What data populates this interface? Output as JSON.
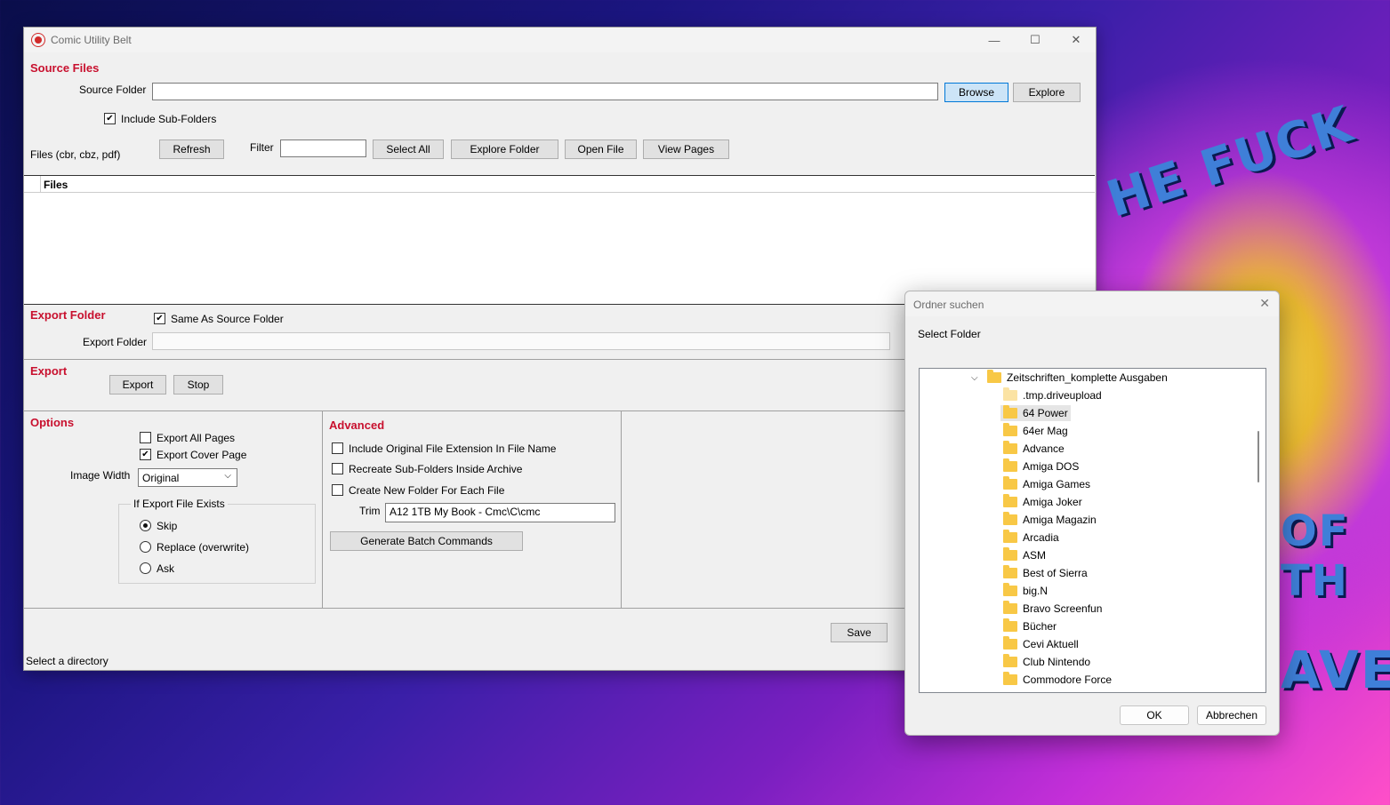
{
  "main": {
    "title": "Comic Utility Belt",
    "source_files": {
      "heading": "Source Files",
      "source_folder_label": "Source Folder",
      "source_folder_value": "",
      "browse": "Browse",
      "explore": "Explore",
      "include_sub_folders": "Include Sub-Folders",
      "files_label": "Files (cbr, cbz, pdf)",
      "refresh": "Refresh",
      "filter_label": "Filter",
      "filter_value": "",
      "select_all": "Select All",
      "explore_folder": "Explore Folder",
      "open_file": "Open File",
      "view_pages": "View Pages",
      "files_column": "Files"
    },
    "export_folder": {
      "heading": "Export Folder",
      "same_as_source": "Same As Source Folder",
      "export_folder_label": "Export Folder",
      "export_folder_value": ""
    },
    "export": {
      "heading": "Export",
      "export": "Export",
      "stop": "Stop"
    },
    "options": {
      "heading": "Options",
      "export_all_pages": "Export All Pages",
      "export_cover_page": "Export Cover Page",
      "image_width_label": "Image Width",
      "image_width_value": "Original",
      "if_exists_group": "If Export File Exists",
      "skip": "Skip",
      "replace": "Replace (overwrite)",
      "ask": "Ask"
    },
    "advanced": {
      "heading": "Advanced",
      "include_original_ext": "Include Original File Extension In File Name",
      "recreate_sub_folders": "Recreate Sub-Folders Inside Archive",
      "create_new_folder": "Create New Folder For Each File",
      "trim_label": "Trim",
      "trim_value": "A12 1TB My Book - Cmc\\C\\cmc",
      "generate_batch": "Generate Batch Commands"
    },
    "save": "Save",
    "status": "Select a directory"
  },
  "dialog": {
    "title": "Ordner suchen",
    "prompt": "Select Folder",
    "root": "Zeitschriften_komplette Ausgaben",
    "items": [
      ".tmp.driveupload",
      "64 Power",
      "64er Mag",
      "Advance",
      "Amiga DOS",
      "Amiga Games",
      "Amiga Joker",
      "Amiga Magazin",
      "Arcadia",
      "ASM",
      "Best of Sierra",
      "big.N",
      "Bravo Screenfun",
      "Bücher",
      "Cevi Aktuell",
      "Club Nintendo",
      "Commodore Force"
    ],
    "selected_item": "64 Power",
    "ok": "OK",
    "cancel": "Abbrechen"
  },
  "colors": {
    "section_heading": "#c8102e",
    "accent": "#0078d7",
    "selected": "#cce8ff"
  }
}
